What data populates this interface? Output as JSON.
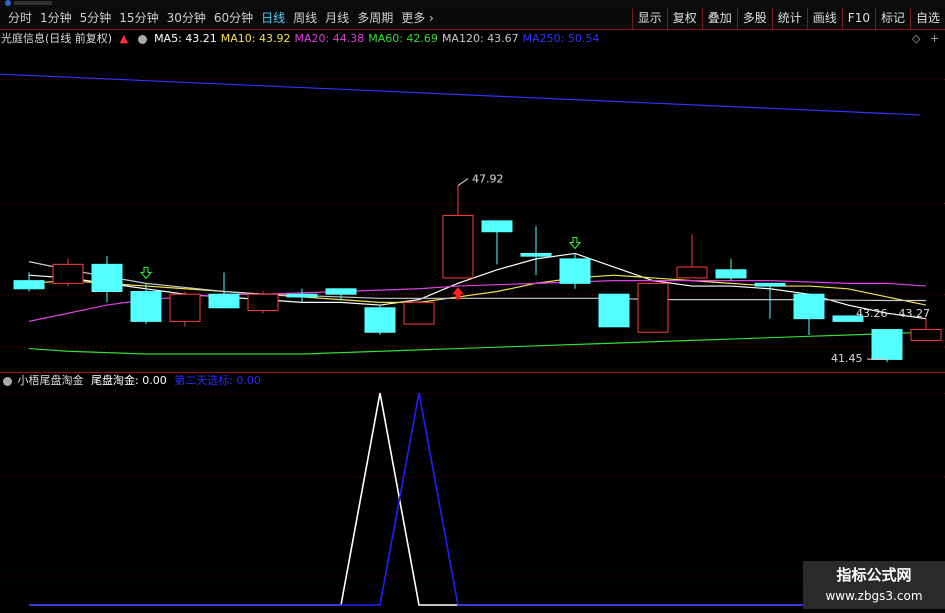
{
  "toolbar": {
    "periods": [
      "分时",
      "1分钟",
      "5分钟",
      "15分钟",
      "30分钟",
      "60分钟",
      "日线",
      "周线",
      "月线",
      "多周期",
      "更多"
    ],
    "active_period": "日线",
    "more_arrow": "›",
    "right_buttons": [
      "显示",
      "复权",
      "叠加",
      "多股",
      "统计",
      "画线",
      "F10",
      "标记",
      "自选"
    ]
  },
  "info": {
    "stock_title": "光庭信息(日线 前复权)",
    "ma": [
      {
        "label": "MA5: 43.21",
        "color": "#ffffff"
      },
      {
        "label": "MA10: 43.92",
        "color": "#f5e24a"
      },
      {
        "label": "MA20: 44.38",
        "color": "#e040e0"
      },
      {
        "label": "MA60: 42.69",
        "color": "#33dd33"
      },
      {
        "label": "MA120: 43.67",
        "color": "#c8c8c8"
      },
      {
        "label": "MA250: 50.54",
        "color": "#3333ff"
      }
    ]
  },
  "annotations": {
    "high": "47.92",
    "low": "41.45",
    "last": "43.26 - 43.27"
  },
  "indicator": {
    "name": "小梧尾盘淘金",
    "v1_label": "尾盘淘金: 0.00",
    "v2_label": "第二天选标: 0.00"
  },
  "watermark": {
    "line1": "指标公式网",
    "line2": "www.zbgs3.com"
  },
  "chart_data": {
    "type": "candlestick",
    "price_range": [
      41.0,
      53.0
    ],
    "candles": [
      {
        "o": 44.4,
        "h": 44.7,
        "l": 44.0,
        "c": 44.1,
        "up": false
      },
      {
        "o": 44.3,
        "h": 45.2,
        "l": 44.2,
        "c": 45.0,
        "up": true
      },
      {
        "o": 45.0,
        "h": 45.3,
        "l": 43.6,
        "c": 44.0,
        "up": false
      },
      {
        "o": 44.0,
        "h": 44.3,
        "l": 42.8,
        "c": 42.9,
        "up": false
      },
      {
        "o": 42.9,
        "h": 44.0,
        "l": 42.7,
        "c": 43.9,
        "up": true
      },
      {
        "o": 43.9,
        "h": 44.7,
        "l": 43.4,
        "c": 43.4,
        "up": false
      },
      {
        "o": 43.3,
        "h": 44.0,
        "l": 43.2,
        "c": 43.9,
        "up": true
      },
      {
        "o": 43.9,
        "h": 44.1,
        "l": 43.6,
        "c": 43.8,
        "up": false
      },
      {
        "o": 43.9,
        "h": 44.1,
        "l": 43.7,
        "c": 44.1,
        "up": false
      },
      {
        "o": 43.4,
        "h": 43.5,
        "l": 42.4,
        "c": 42.5,
        "up": false
      },
      {
        "o": 42.8,
        "h": 43.6,
        "l": 42.8,
        "c": 43.6,
        "up": true
      },
      {
        "o": 44.5,
        "h": 47.9,
        "l": 44.5,
        "c": 46.8,
        "up": true
      },
      {
        "o": 46.6,
        "h": 46.6,
        "l": 45.0,
        "c": 46.2,
        "up": false
      },
      {
        "o": 45.4,
        "h": 46.4,
        "l": 44.6,
        "c": 45.3,
        "up": false
      },
      {
        "o": 45.2,
        "h": 45.4,
        "l": 44.1,
        "c": 44.3,
        "up": false
      },
      {
        "o": 43.9,
        "h": 43.9,
        "l": 42.7,
        "c": 42.7,
        "up": false
      },
      {
        "o": 42.5,
        "h": 44.3,
        "l": 42.5,
        "c": 44.3,
        "up": true
      },
      {
        "o": 44.5,
        "h": 46.1,
        "l": 44.5,
        "c": 44.9,
        "up": true
      },
      {
        "o": 44.8,
        "h": 45.2,
        "l": 44.4,
        "c": 44.5,
        "up": false
      },
      {
        "o": 44.3,
        "h": 44.3,
        "l": 43.0,
        "c": 44.2,
        "up": false
      },
      {
        "o": 43.9,
        "h": 43.9,
        "l": 42.4,
        "c": 43.0,
        "up": false
      },
      {
        "o": 43.1,
        "h": 43.1,
        "l": 42.9,
        "c": 42.9,
        "up": false
      },
      {
        "o": 42.6,
        "h": 42.6,
        "l": 41.4,
        "c": 41.5,
        "up": false
      },
      {
        "o": 42.6,
        "h": 43.0,
        "l": 42.2,
        "c": 42.2,
        "up": true
      }
    ],
    "series": [
      {
        "name": "MA250",
        "color": "#3333ff",
        "values": [
          52.0,
          50.5
        ]
      },
      {
        "name": "MA5",
        "color": "#ffffff",
        "values": [
          44.6,
          44.5,
          44.3,
          44.1,
          43.9,
          43.8,
          43.7,
          43.6,
          43.6,
          43.5,
          43.7,
          44.3,
          44.8,
          45.2,
          45.4,
          44.9,
          44.4,
          44.2,
          44.2,
          44.1,
          43.9,
          43.5,
          43.2,
          43.0
        ]
      },
      {
        "name": "MA10",
        "color": "#f5e24a",
        "values": [
          44.3,
          44.4,
          44.3,
          44.2,
          44.1,
          44.0,
          43.9,
          43.8,
          43.7,
          43.6,
          43.6,
          43.8,
          44.0,
          44.3,
          44.5,
          44.6,
          44.5,
          44.4,
          44.3,
          44.2,
          44.2,
          44.1,
          43.8,
          43.5
        ]
      },
      {
        "name": "MA20",
        "color": "#e040e0",
        "values": [
          42.9,
          43.2,
          43.5,
          43.7,
          43.8,
          43.9,
          43.9,
          43.95,
          44.0,
          44.05,
          44.1,
          44.2,
          44.25,
          44.3,
          44.35,
          44.4,
          44.4,
          44.4,
          44.4,
          44.4,
          44.35,
          44.3,
          44.3,
          44.2
        ]
      },
      {
        "name": "MA60",
        "color": "#33dd33",
        "values": [
          41.9,
          41.8,
          41.75,
          41.7,
          41.7,
          41.7,
          41.7,
          41.7,
          41.75,
          41.8,
          41.85,
          41.9,
          41.95,
          42.0,
          42.05,
          42.1,
          42.15,
          42.2,
          42.25,
          42.3,
          42.35,
          42.4,
          42.45,
          42.5
        ]
      },
      {
        "name": "MA120",
        "color": "#c8c8c8",
        "values": [
          45.1,
          44.8,
          44.55,
          44.3,
          44.15,
          44.0,
          43.9,
          43.85,
          43.8,
          43.75,
          43.75,
          43.75,
          43.75,
          43.75,
          43.75,
          43.75,
          43.7,
          43.7,
          43.7,
          43.7,
          43.7,
          43.68,
          43.67,
          43.67
        ]
      }
    ],
    "indicator_series": [
      {
        "name": "尾盘淘金",
        "color": "#ffffff",
        "values": [
          0,
          0,
          0,
          0,
          0,
          0,
          0,
          0,
          0,
          1,
          0,
          0,
          0,
          0,
          0,
          0,
          0,
          0,
          0,
          0,
          0,
          0,
          0,
          0
        ]
      },
      {
        "name": "第二天选标",
        "color": "#2020ff",
        "values": [
          0,
          0,
          0,
          0,
          0,
          0,
          0,
          0,
          0,
          0,
          1,
          0,
          0,
          0,
          0,
          0,
          0,
          0,
          0,
          0,
          0,
          0,
          0,
          0
        ]
      }
    ]
  }
}
